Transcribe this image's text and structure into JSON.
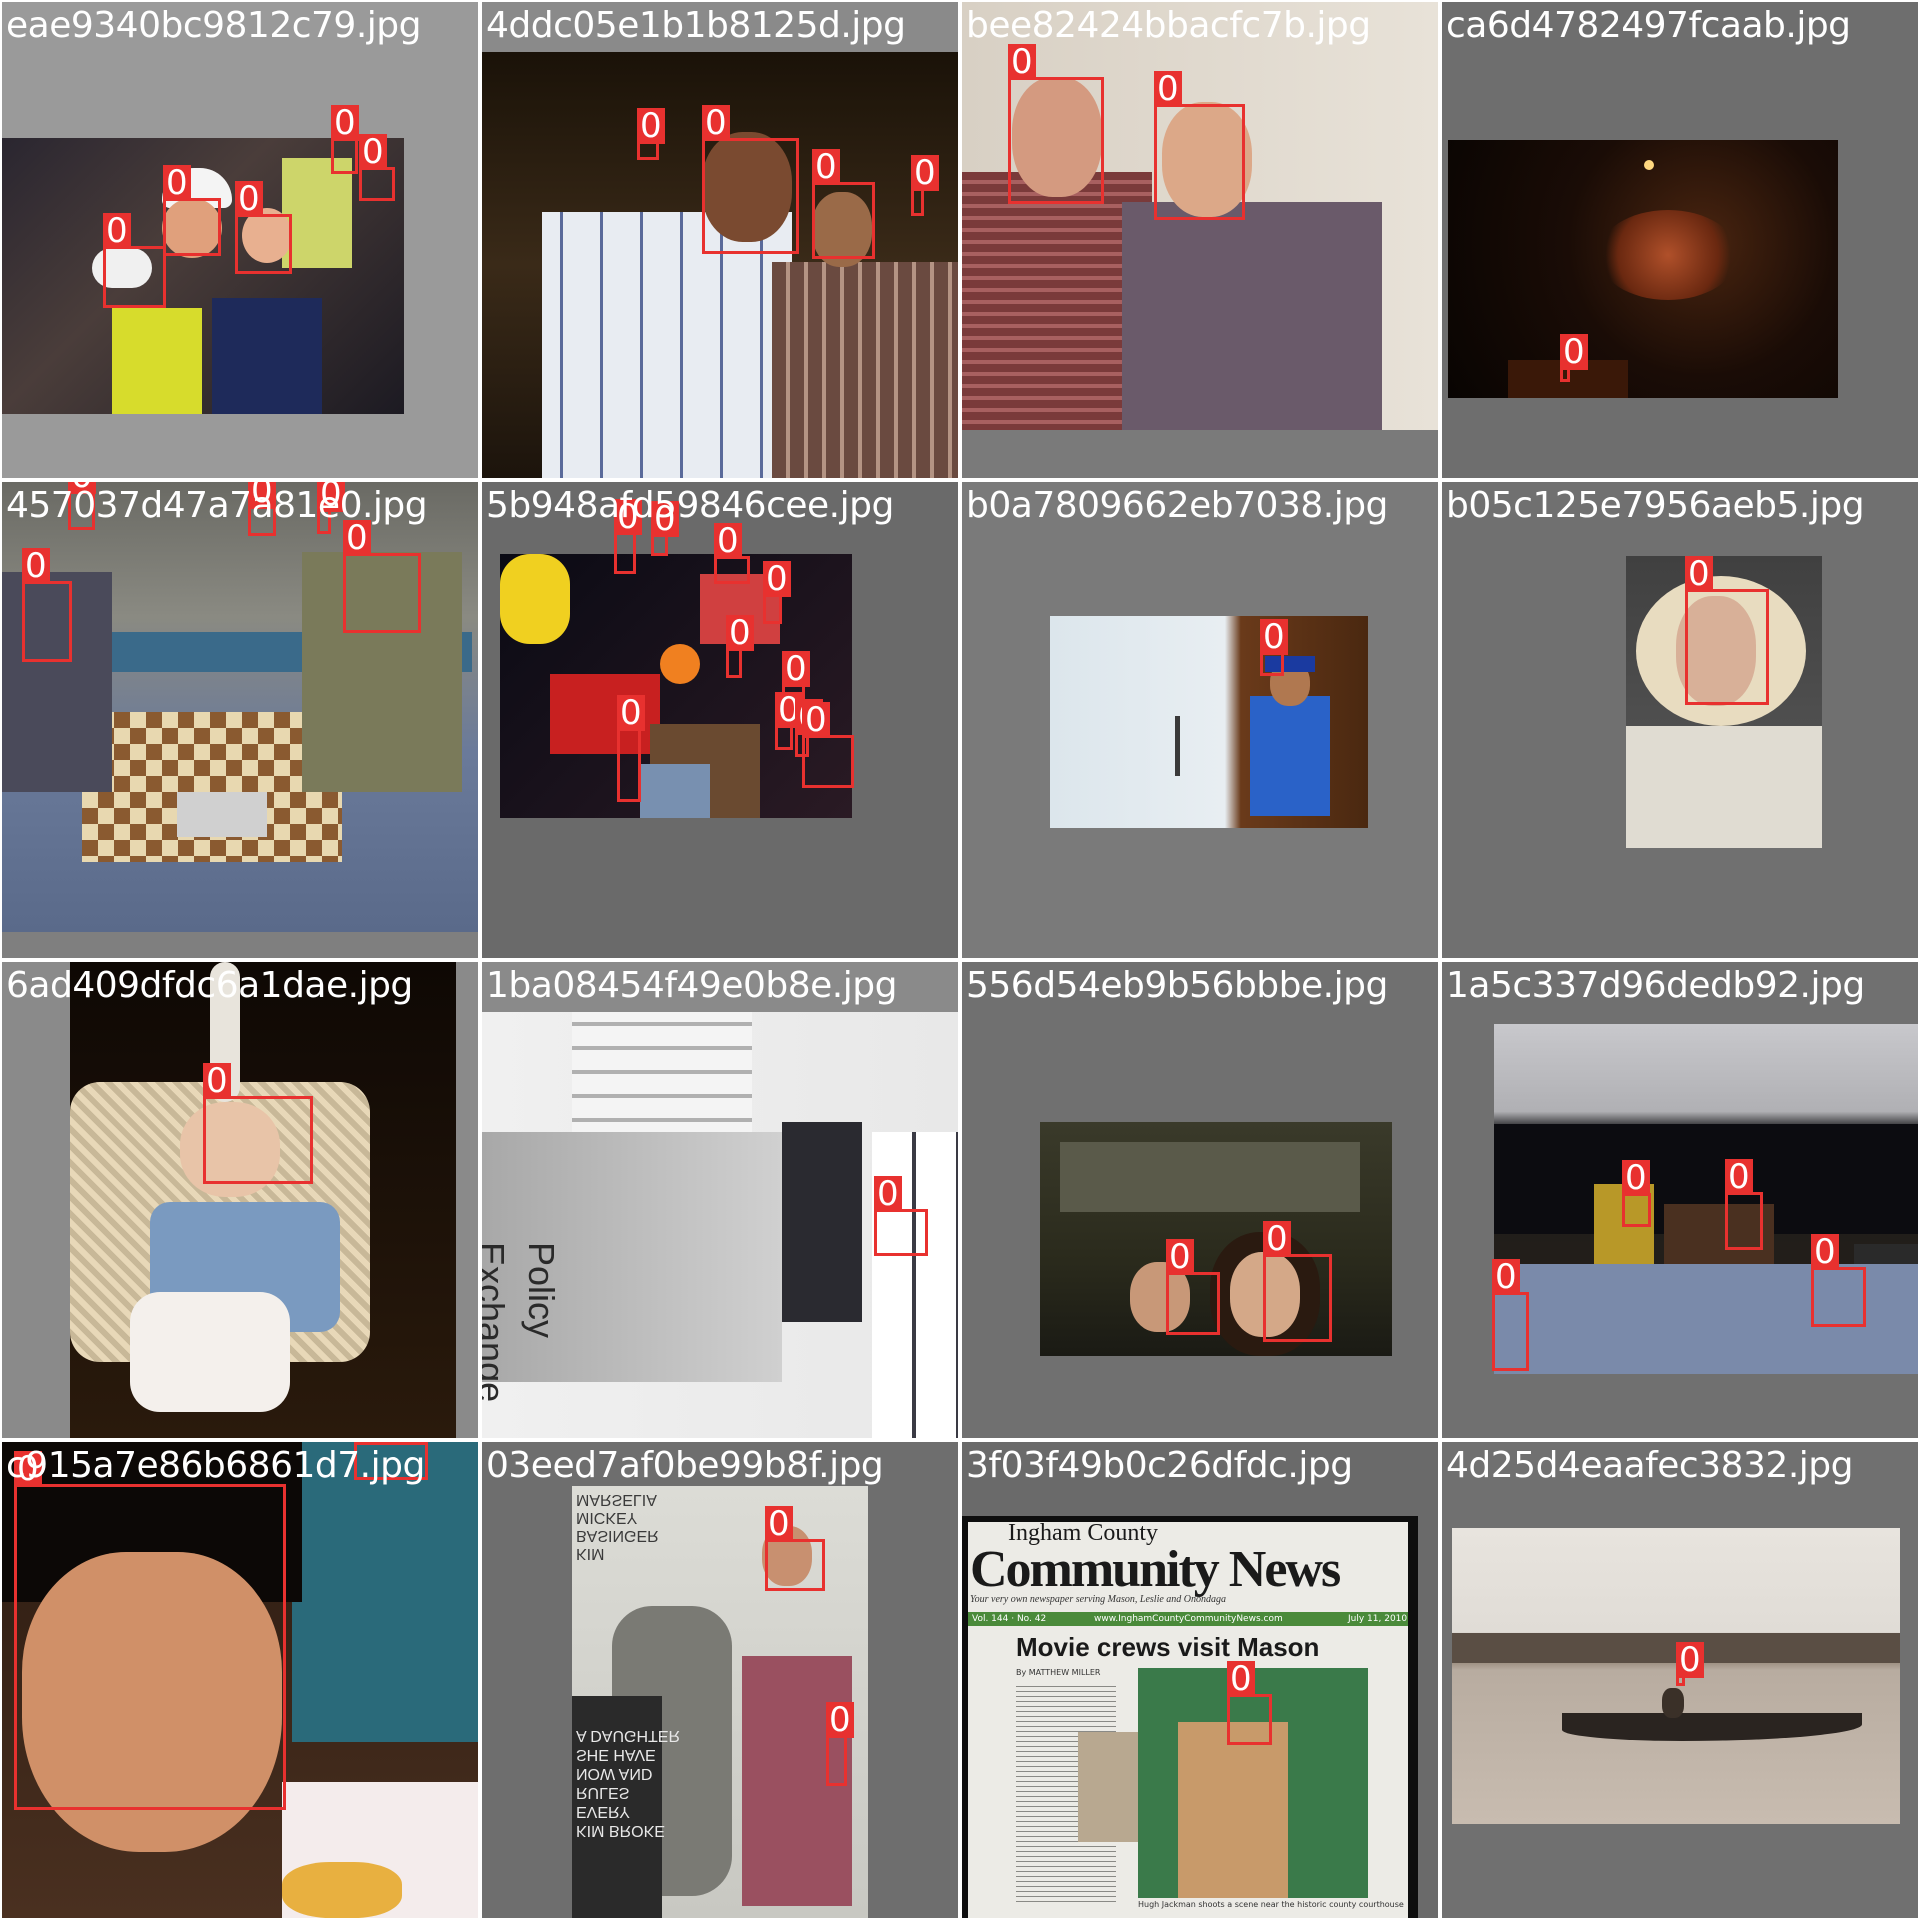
{
  "colors": {
    "box": "#e8312f",
    "filename_text": "#ffffff"
  },
  "tiles": [
    {
      "filename": "eae9340bc9812c79.jpg",
      "bg": "#9a9a9a",
      "box_label": "0"
    },
    {
      "filename": "4ddc05e1b1b8125d.jpg",
      "bg": "#8a8a8a",
      "box_label": "0"
    },
    {
      "filename": "bee82424bbacfc7b.jpg",
      "bg": "#7a7a7a",
      "box_label": "0"
    },
    {
      "filename": "ca6d4782497fcaab.jpg",
      "bg": "#6e6e6e",
      "box_label": "0"
    },
    {
      "filename": "457037d47a7a81e0.jpg",
      "bg": "#7f7f7f",
      "box_label": "0"
    },
    {
      "filename": "5b948afd59846cee.jpg",
      "bg": "#6a6a6a",
      "box_label": "0"
    },
    {
      "filename": "b0a7809662eb7038.jpg",
      "bg": "#7a7a7a",
      "box_label": "0"
    },
    {
      "filename": "b05c125e7956aeb5.jpg",
      "bg": "#707070",
      "box_label": "0"
    },
    {
      "filename": "6ad409dfdc6a1dae.jpg",
      "bg": "#8a8a8a",
      "box_label": "0"
    },
    {
      "filename": "1ba08454f49e0b8e.jpg",
      "bg": "#8a8a8a",
      "box_label": "0"
    },
    {
      "filename": "556d54eb9b56bbbe.jpg",
      "bg": "#707070",
      "box_label": "0"
    },
    {
      "filename": "1a5c337d96dedb92.jpg",
      "bg": "#707070",
      "box_label": "0"
    },
    {
      "filename": "c915a7e86b6861d7.jpg",
      "bg": "#8a8a8a",
      "box_label": "0"
    },
    {
      "filename": "03eed7af0be99b8f.jpg",
      "bg": "#6e6e6e",
      "box_label": "0"
    },
    {
      "filename": "3f03f49b0c26dfdc.jpg",
      "bg": "#6a6a6a",
      "box_label": "0"
    },
    {
      "filename": "4d25d4eaafec3832.jpg",
      "bg": "#707070",
      "box_label": "0"
    }
  ],
  "news": {
    "masthead_small": "Ingham County",
    "masthead": "Community News",
    "tagline": "Your very own newspaper serving Mason, Leslie and Onondaga",
    "volume": "Vol. 144 · No. 42",
    "website": "www.InghamCountyCommunityNews.com",
    "date": "July 11, 2010",
    "headline": "Movie crews visit Mason",
    "byline": "By MATTHEW MILLER",
    "caption": "Hugh Jackman shoots a scene near the historic county courthouse"
  },
  "poster": {
    "top_lines": "KIM\nBASINGER\nMICKEY\nMARSELIA",
    "bottom_lines": "KIM BROKE\nEVERY\nRULES\nNOW AND\nSHE HAVE\nA DAUGHTER"
  },
  "banner": {
    "word1": "Exchange",
    "word2": "Policy"
  }
}
